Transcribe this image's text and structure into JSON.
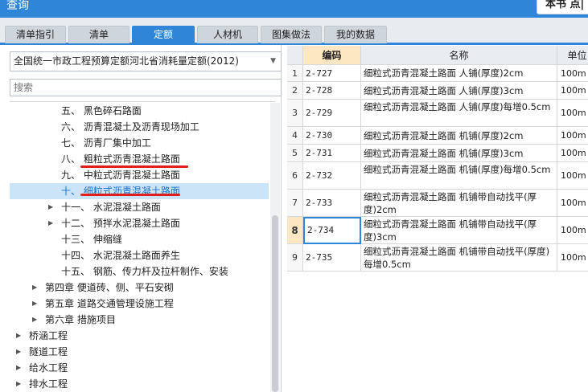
{
  "window": {
    "title": "查询",
    "top_right_button": "本书 点|"
  },
  "tabs": [
    {
      "label": "清单指引",
      "active": false
    },
    {
      "label": "清单",
      "active": false
    },
    {
      "label": "定额",
      "active": true
    },
    {
      "label": "人材机",
      "active": false
    },
    {
      "label": "图集做法",
      "active": false
    },
    {
      "label": "我的数据",
      "active": false
    }
  ],
  "library_select": {
    "value": "全国统一市政工程预算定额河北省消耗量定额(2012)"
  },
  "search": {
    "placeholder": "搜索"
  },
  "tree": [
    {
      "label": "五、 黑色碎石路面",
      "expander": false
    },
    {
      "label": "六、 沥青混凝土及沥青现场加工",
      "expander": false
    },
    {
      "label": "七、 沥青厂集中加工",
      "expander": false
    },
    {
      "label": "八、 粗粒式沥青混凝土路面",
      "expander": false
    },
    {
      "label": "九、 中粒式沥青混凝土路面",
      "expander": false
    },
    {
      "label": "十、 细粒式沥青混凝土路面",
      "expander": false,
      "selected": true
    },
    {
      "label": "十一、 水泥混凝土路面",
      "expander": true
    },
    {
      "label": "十二、 预拌水泥混凝土路面",
      "expander": true
    },
    {
      "label": "十三、 伸缩缝",
      "expander": false
    },
    {
      "label": "十四、 水泥混凝土路面养生",
      "expander": false
    },
    {
      "label": "十五、 钢筋、传力杆及拉杆制作、安装",
      "expander": false
    },
    {
      "label": "第四章 便道砖、侧、平石安砌",
      "expander": true
    },
    {
      "label": "第五章 道路交通管理设施工程",
      "expander": true
    },
    {
      "label": "第六章 措施项目",
      "expander": true
    },
    {
      "label": "桥涵工程",
      "expander": true
    },
    {
      "label": "隧道工程",
      "expander": true
    },
    {
      "label": "给水工程",
      "expander": true
    },
    {
      "label": "排水工程",
      "expander": true
    }
  ],
  "grid": {
    "headers": {
      "code": "编码",
      "name": "名称",
      "unit": "单位"
    },
    "rows": [
      {
        "num": "1",
        "code": "2-727",
        "name": "细粒式沥青混凝土路面 人铺(厚度)2cm",
        "unit": "100m"
      },
      {
        "num": "2",
        "code": "2-728",
        "name": "细粒式沥青混凝土路面 人铺(厚度)3cm",
        "unit": "100m"
      },
      {
        "num": "3",
        "code": "2-729",
        "name": "细粒式沥青混凝土路面 人铺(厚度)每增0.5cm",
        "unit": "100m"
      },
      {
        "num": "4",
        "code": "2-730",
        "name": "细粒式沥青混凝土路面 机铺(厚度)2cm",
        "unit": "100m"
      },
      {
        "num": "5",
        "code": "2-731",
        "name": "细粒式沥青混凝土路面 机铺(厚度)3cm",
        "unit": "100m"
      },
      {
        "num": "6",
        "code": "2-732",
        "name": "细粒式沥青混凝土路面 机铺(厚度)每增0.5cm",
        "unit": "100m"
      },
      {
        "num": "7",
        "code": "2-733",
        "name": "细粒式沥青混凝土路面 机铺带自动找平(厚度)2cm",
        "unit": "100m"
      },
      {
        "num": "8",
        "code": "2-734",
        "name": "细粒式沥青混凝土路面 机铺带自动找平(厚度)3cm",
        "unit": "100m",
        "active": true
      },
      {
        "num": "9",
        "code": "2-735",
        "name": "细粒式沥青混凝土路面 机铺带自动找平(厚度)每增0.5cm",
        "unit": "100m"
      }
    ]
  },
  "colors": {
    "accent": "#2f86d8",
    "selected_row": "#cce4f7",
    "active_header": "#fde7c2",
    "annotation": "#e01e1e"
  }
}
